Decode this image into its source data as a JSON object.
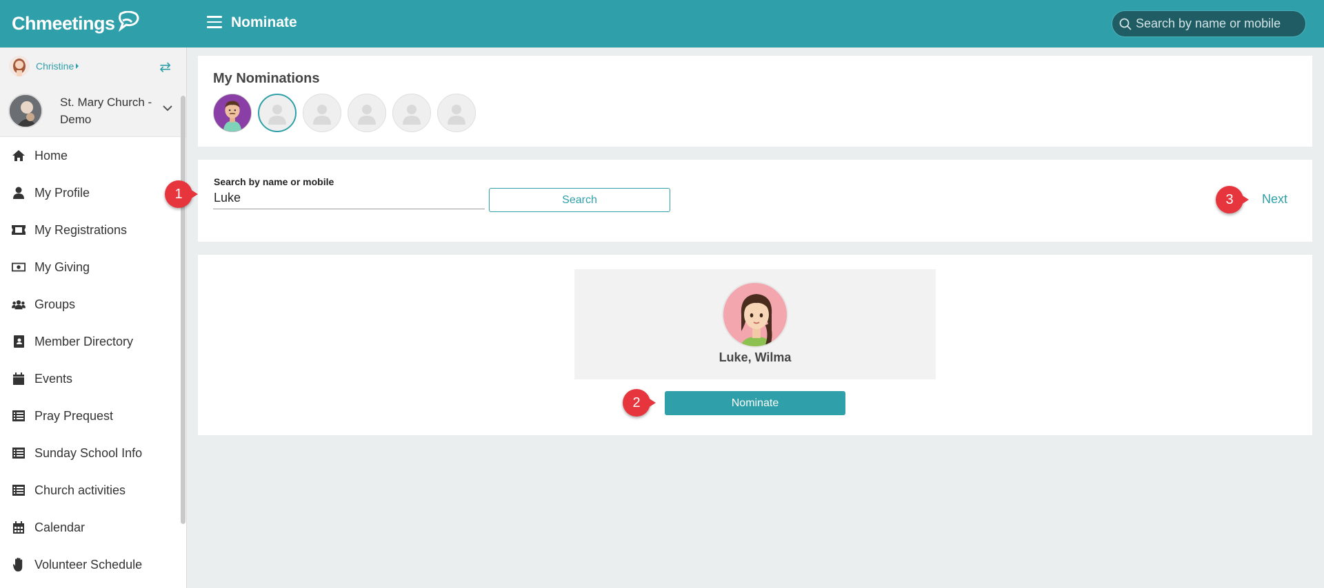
{
  "app": {
    "brand": "Chmeetings",
    "page_title": "Nominate"
  },
  "top_search": {
    "placeholder": "Search by name or mobile"
  },
  "sidebar": {
    "user_name": "Christine",
    "church_name": "St. Mary Church - Demo",
    "items": [
      {
        "label": "Home",
        "icon": "home-icon"
      },
      {
        "label": "My Profile",
        "icon": "person-icon"
      },
      {
        "label": "My Registrations",
        "icon": "ticket-icon"
      },
      {
        "label": "My Giving",
        "icon": "money-icon"
      },
      {
        "label": "Groups",
        "icon": "users-icon"
      },
      {
        "label": "Member Directory",
        "icon": "address-book-icon"
      },
      {
        "label": "Events",
        "icon": "calendar-icon"
      },
      {
        "label": "Pray Prequest",
        "icon": "list-icon"
      },
      {
        "label": "Sunday School Info",
        "icon": "list-icon"
      },
      {
        "label": "Church activities",
        "icon": "list-icon"
      },
      {
        "label": "Calendar",
        "icon": "calendar-grid-icon"
      },
      {
        "label": "Volunteer Schedule",
        "icon": "hand-icon"
      }
    ]
  },
  "nominations": {
    "title": "My Nominations",
    "slots_total": 6,
    "slots_filled": 1
  },
  "search": {
    "label": "Search by name or mobile",
    "value": "Luke",
    "button": "Search",
    "next": "Next"
  },
  "result": {
    "name": "Luke, Wilma",
    "button": "Nominate"
  },
  "markers": [
    "1",
    "2",
    "3"
  ],
  "colors": {
    "brand": "#2f9fa9",
    "marker": "#e6353d",
    "background": "#eaeeef"
  }
}
